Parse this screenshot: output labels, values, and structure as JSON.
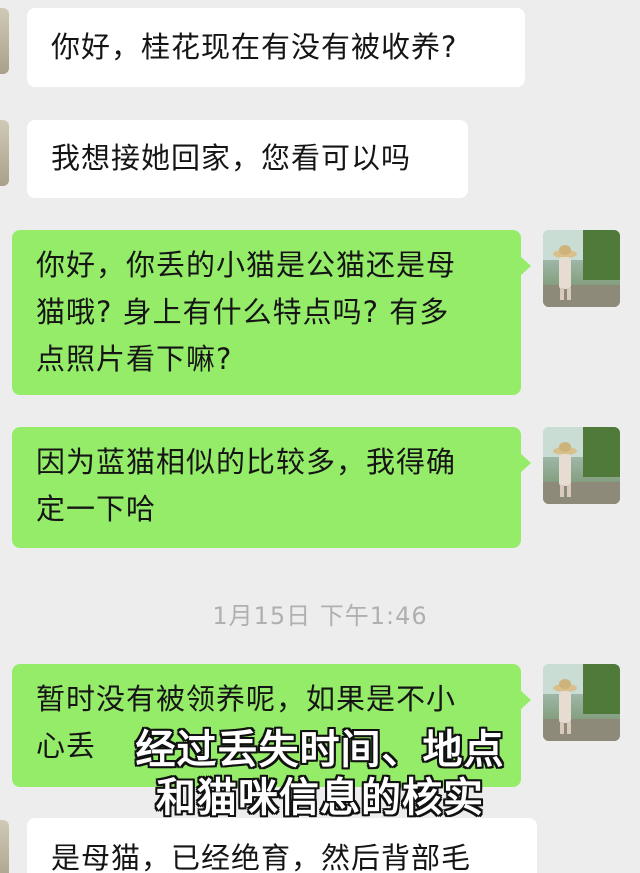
{
  "messages": [
    {
      "from": "other",
      "lines": [
        "你好，桂花现在有没有被收养?"
      ]
    },
    {
      "from": "other",
      "lines": [
        "我想接她回家，您看可以吗"
      ]
    },
    {
      "from": "self",
      "lines": [
        "你好，你丢的小猫是公猫还是母",
        "猫哦? 身上有什么特点吗? 有多",
        "点照片看下嘛?"
      ]
    },
    {
      "from": "self",
      "lines": [
        "因为蓝猫相似的比较多，我得确",
        "定一下哈"
      ]
    },
    {
      "from": "self",
      "lines": [
        "暂时没有被领养呢，如果是不小",
        "心丢"
      ]
    },
    {
      "from": "other",
      "lines": [
        "是母猫，已经绝育，然后背部毛"
      ]
    }
  ],
  "timestamp": "1月15日 下午1:46",
  "caption": {
    "line1": "经过丢失时间、地点",
    "line2": "和猫咪信息的核实"
  },
  "avatar_icon": "user-avatar-woman-with-straw-hat",
  "colors": {
    "background": "#ededed",
    "incoming_bubble": "#ffffff",
    "outgoing_bubble": "#95ec69",
    "timestamp": "#b0b0b0"
  }
}
